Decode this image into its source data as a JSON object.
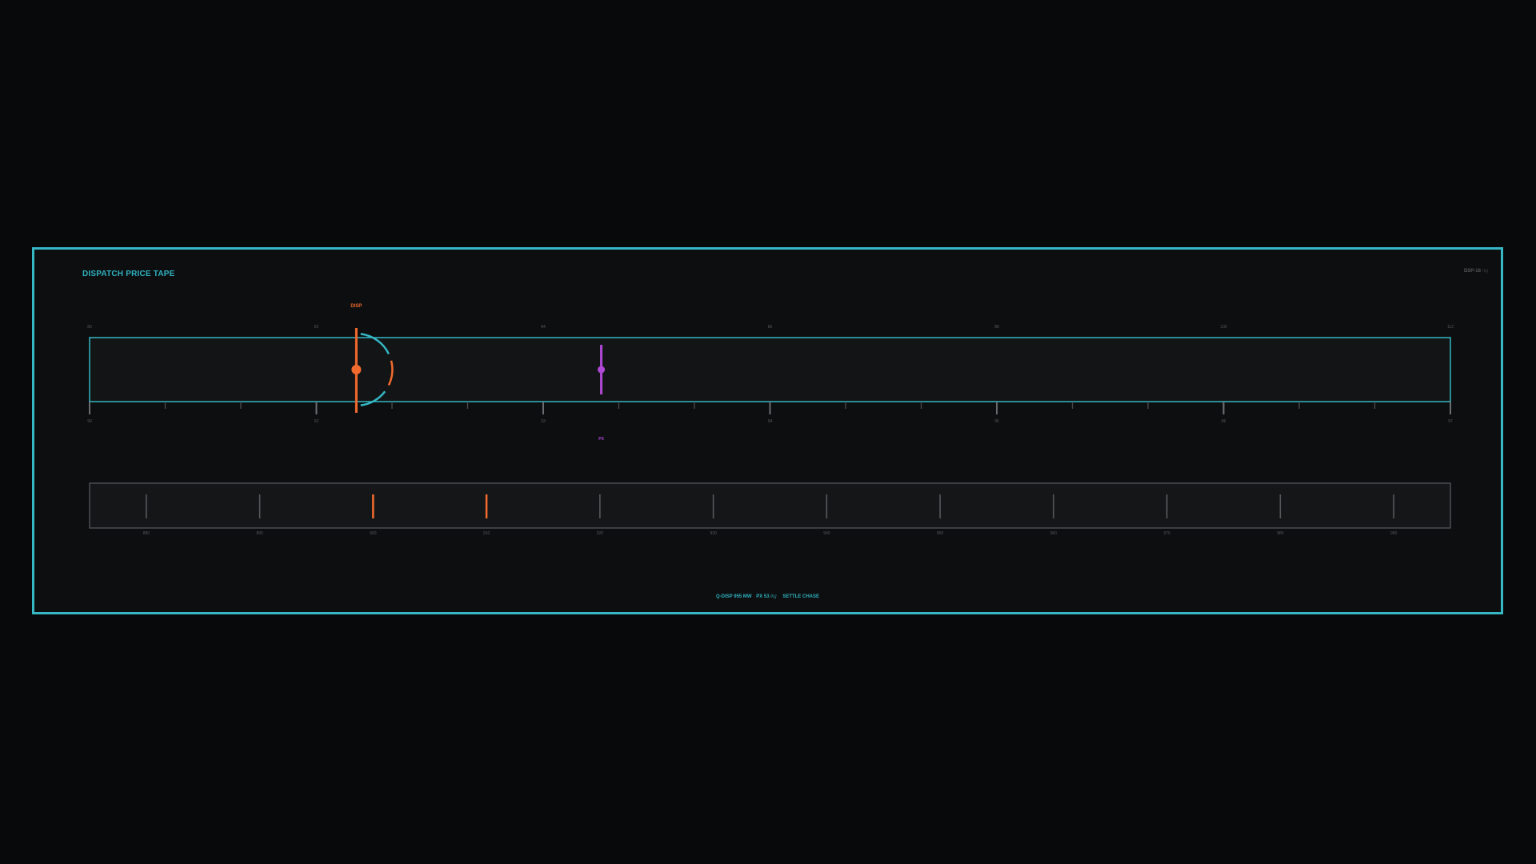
{
  "panel": {
    "title": "DISPATCH PRICE TAPE",
    "code": "DSP-18",
    "code_unit": "rtg"
  },
  "tape": {
    "top_labels": [
      "80",
      "82",
      "84",
      "86",
      "88",
      "100",
      "112"
    ],
    "bottom_labels": [
      "90",
      "92",
      "93",
      "94",
      "95",
      "96",
      "97"
    ],
    "markers": [
      {
        "name": "disp",
        "label": "DISP",
        "color": "#f26a2e",
        "position": 0.196
      },
      {
        "name": "px",
        "label": "PX",
        "color": "#b048d6",
        "position": 0.376
      }
    ]
  },
  "strip": {
    "labels": [
      "880",
      "890",
      "900",
      "910",
      "920",
      "930",
      "940",
      "950",
      "960",
      "970",
      "980",
      "990"
    ],
    "active": [
      2,
      3
    ],
    "active_color": "#f26a2e",
    "idle_color": "#5a5e60"
  },
  "footer": {
    "q_text": "Q-DISP 955 MW",
    "px_text": "PX 53",
    "px_unit": "/kg",
    "settle_text": "SETTLE CHASE"
  },
  "colors": {
    "accent": "#35b7c4",
    "disp": "#f26a2e",
    "px": "#b048d6"
  }
}
